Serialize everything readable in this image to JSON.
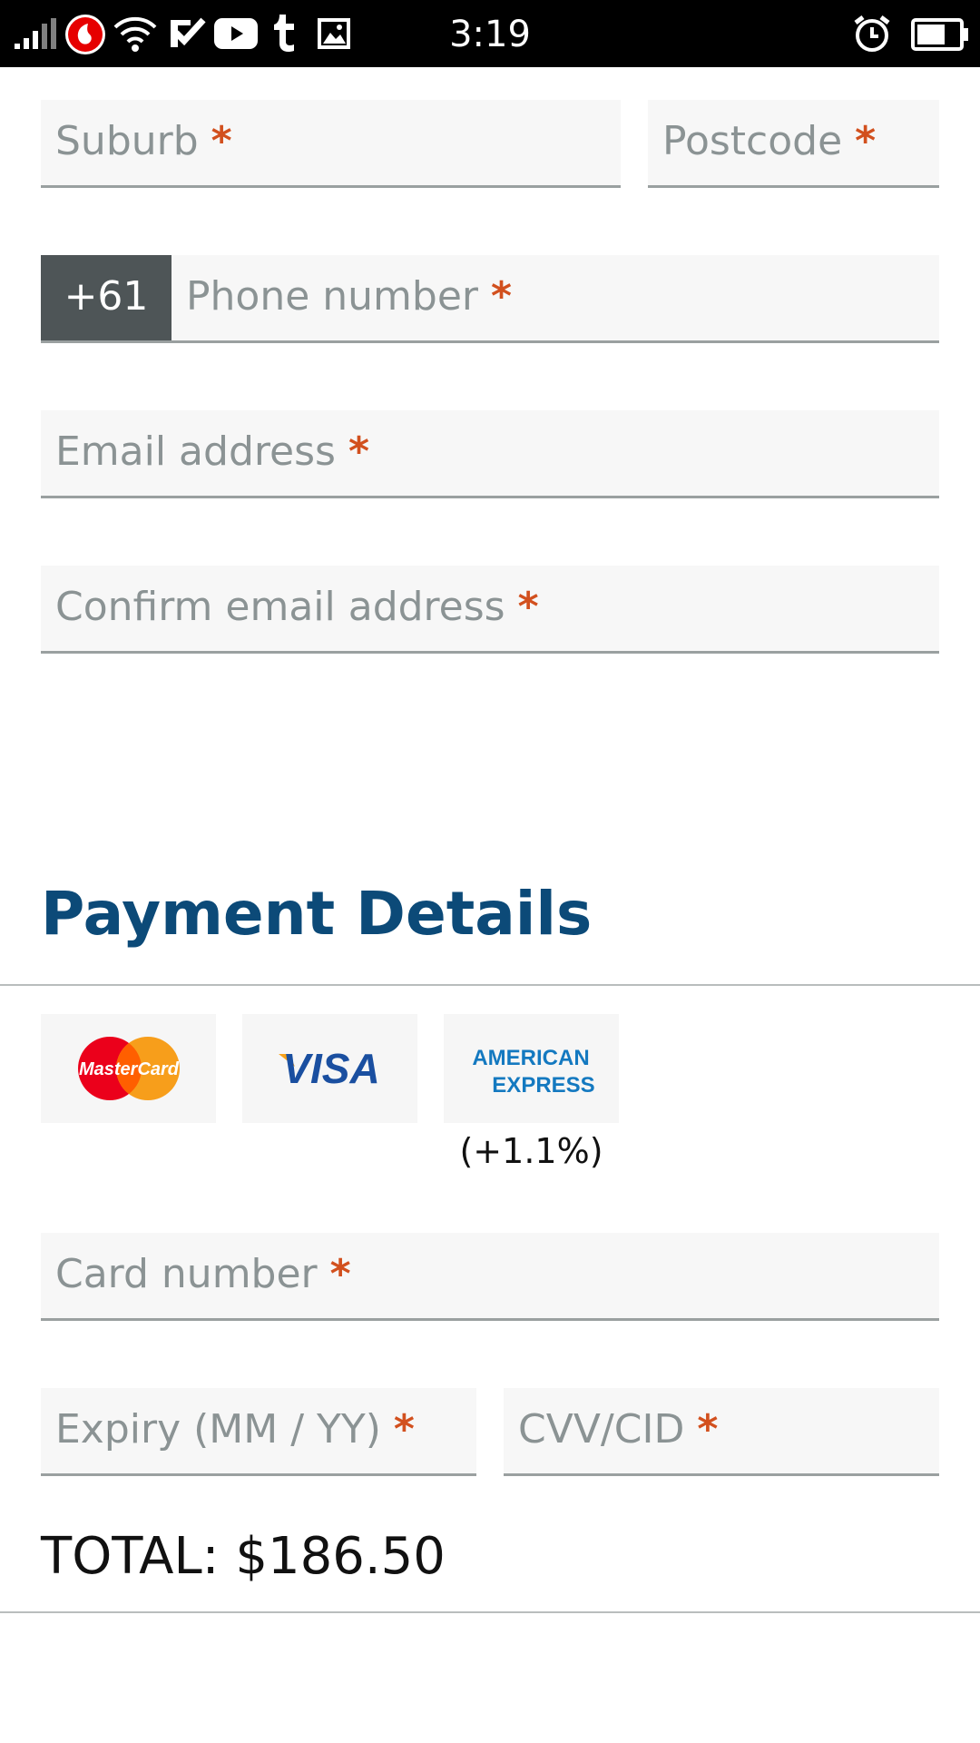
{
  "status_bar": {
    "time": "3:19",
    "left_icons": [
      "signal-icon",
      "vodafone-icon",
      "wifi-icon",
      "check-notification-icon",
      "youtube-icon",
      "tumblr-icon",
      "image-icon"
    ],
    "right_icons": [
      "alarm-icon",
      "battery-icon"
    ],
    "colors": {
      "background": "#000000",
      "foreground": "#ffffff",
      "vodafone": "#e60000"
    }
  },
  "contact_fields": {
    "suburb": {
      "placeholder": "Suburb",
      "required_mark": "*"
    },
    "postcode": {
      "placeholder": "Postcode",
      "required_mark": "*"
    },
    "phone": {
      "prefix": "+61",
      "placeholder": "Phone number",
      "required_mark": "*"
    },
    "email": {
      "placeholder": "Email address",
      "required_mark": "*"
    },
    "confirm_email": {
      "placeholder": "Confirm email address",
      "required_mark": "*"
    }
  },
  "payment": {
    "title": "Payment Details",
    "cards": [
      {
        "name": "mastercard",
        "logo_text": "MasterCard"
      },
      {
        "name": "visa",
        "logo_text": "VISA"
      },
      {
        "name": "amex",
        "logo_text": "AMERICAN EXPRESS"
      }
    ],
    "amex_surcharge": "(+1.1%)",
    "card_number": {
      "placeholder": "Card number",
      "required_mark": "*"
    },
    "expiry": {
      "placeholder": "Expiry (MM / YY)",
      "required_mark": "*"
    },
    "cvv": {
      "placeholder": "CVV/CID",
      "required_mark": "*"
    },
    "total": "TOTAL: $186.50"
  },
  "colors": {
    "title": "#0c4a78",
    "required": "#d2501e",
    "placeholder": "#8b9394",
    "field_bg": "#f7f7f7",
    "field_border": "#9aa0a0",
    "prefix_bg": "#4e5557"
  }
}
